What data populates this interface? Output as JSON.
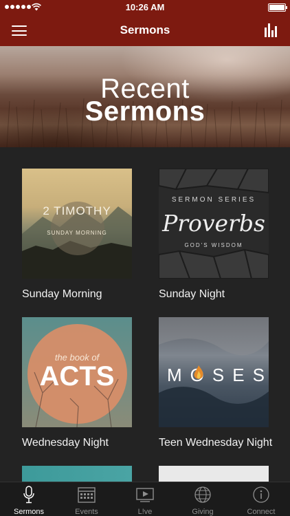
{
  "status_bar": {
    "time": "10:26 AM"
  },
  "nav": {
    "title": "Sermons",
    "menu_icon": "hamburger-menu-icon",
    "right_icon": "bar-chart-icon"
  },
  "hero": {
    "line1": "Recent",
    "line2": "Sermons"
  },
  "sermons": [
    {
      "label": "Sunday Morning",
      "art": {
        "title": "2 TIMOTHY",
        "subtitle": "SUNDAY MORNING"
      }
    },
    {
      "label": "Sunday Night",
      "art": {
        "top": "SERMON SERIES",
        "title": "Proverbs",
        "subtitle": "GOD'S WISDOM"
      }
    },
    {
      "label": "Wednesday Night",
      "art": {
        "top": "the book of",
        "title": "ACTS"
      }
    },
    {
      "label": "Teen Wednesday Night",
      "art": {
        "title": "MOSES"
      }
    }
  ],
  "tabs": [
    {
      "label": "Sermons",
      "icon": "microphone-icon",
      "active": true
    },
    {
      "label": "Events",
      "icon": "calendar-icon",
      "active": false
    },
    {
      "label": "L!ve",
      "icon": "video-play-icon",
      "active": false
    },
    {
      "label": "Giving",
      "icon": "globe-icon",
      "active": false
    },
    {
      "label": "Connect",
      "icon": "info-icon",
      "active": false
    }
  ],
  "colors": {
    "header": "#7d1a10",
    "background": "#232323",
    "tabbar": "#1b1b1b"
  }
}
